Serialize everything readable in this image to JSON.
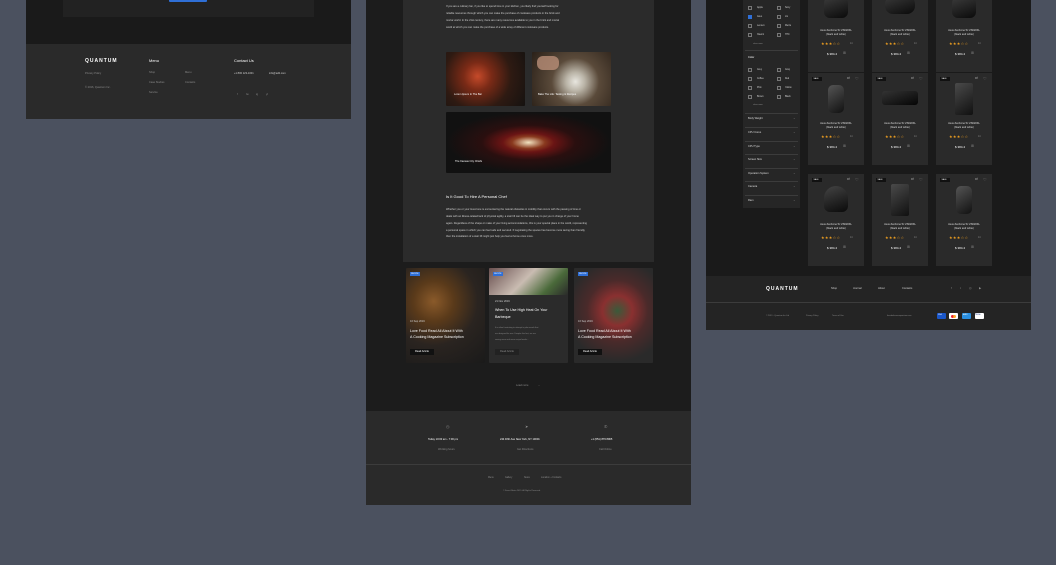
{
  "left": {
    "brand": "QUANTUM",
    "privacy": "Privacy Policy",
    "copyright": "© 2016, Quantum Inc.",
    "menu_title": "Menu",
    "menu_col1": [
      "Shop",
      "Case Studies",
      "Service"
    ],
    "menu_col2": [
      "Menu",
      "Contacts"
    ],
    "contact_title": "Contact Us",
    "phone": "+1 800 123-1001",
    "email": "info@adb.com",
    "social": [
      "f",
      "tw",
      "ig",
      "yt"
    ]
  },
  "middle": {
    "paragraph1": [
      "If you are a culinary fan, if you like to spend time in your kitchen, you likely find yourself looking for",
      "reliable resources through which you can make the purchase of cookware products in the brick and",
      "mortar world. In the 21st century, there are many resources available to you in the brick and mortal",
      "world at which you can make the purchase of a wide array of different cookware products."
    ],
    "photo1_caption": "Lorem Ipsum In The Bar",
    "photo2_caption": "Bake The Life: Tasting & Recipes",
    "photo3_caption": "The Kansas City Chiefs",
    "section_heading": "Is It Good To Hire A Personal Chef",
    "paragraph2": [
      "Whether you or your loved one is encountering the natural obstacles in mobility that occurs with the passing of time or",
      "deals with an illness-related lack of physical agility, a stair lift can be the ideal way to put you in charge of your home",
      "again. Regardless of the shape or make of your living accommodations, this is your special place in the world, representing",
      "a personal space in which you can feel safe and secured. If negotiating the spaces has become more taxing than friendly,",
      "then the installation of a stair lift might just help you feel at home once more."
    ],
    "posts": [
      {
        "tag": "RECIPE",
        "date": "16 Sep 2019",
        "title_lines": [
          "Love Food Read All About It With",
          "A Cooking Magazine Subscription"
        ],
        "button": "Read Article"
      },
      {
        "tag": "RECIPE",
        "date": "21 Nov 2019",
        "title_lines": [
          "When To Use High Heat On Your",
          "Barbeque"
        ],
        "excerpt_lines": [
          "It is often frustrating to attempt to plan meals that",
          "are designed for one. Despite this fact, we are",
          "seeing more and more recipe books..."
        ],
        "button": "Read Article"
      },
      {
        "tag": "RECIPE",
        "date": "16 Sep 2019",
        "title_lines": [
          "Love Food Read All About It With",
          "A Cooking Magazine Subscription"
        ],
        "button": "Read Article"
      }
    ],
    "load_more": "Load more",
    "footer_info": [
      {
        "icon": "clock-icon",
        "glyph": "◷",
        "main": "Today 10:00 am - 7:00 pm",
        "sub": "Working hours"
      },
      {
        "icon": "location-icon",
        "glyph": "➤",
        "main": "244 Fifth Ave New York, NY 10001",
        "sub": "Get Directions"
      },
      {
        "icon": "phone-icon",
        "glyph": "✆",
        "main": "+1 (651) 876 8965",
        "sub": "Call Online"
      }
    ],
    "footer_links": [
      "Menu",
      "Gallery",
      "News",
      "Location + Contacts"
    ],
    "footer_copyright": "© Saucé Bistro 2019. All Rights Reserved."
  },
  "right": {
    "top_filters_col1": [
      "Apple",
      "Asus",
      "Lenovo",
      "Xiaomi"
    ],
    "top_filters_col2": [
      "Sony",
      "LG",
      "Meizu",
      "HTC"
    ],
    "show_more": "show more",
    "color_title": "Color",
    "colors_col1": [
      "Grey",
      "Coffee",
      "Pink",
      "Brown"
    ],
    "colors_col2": [
      "Gray",
      "Red",
      "Yellow",
      "Black"
    ],
    "filter_sections": [
      "Body Weight",
      "CPU Cores",
      "CPU Type",
      "Screen Size",
      "Operation System",
      "Camera",
      "Ram"
    ],
    "product_name_line1": "Asus ZenFone 5z ZS620KL",
    "product_name_line2": "(black and white)",
    "price": "$ 384.4",
    "rating_count": "14",
    "sale_badge": "SALE",
    "brand": "QUANTUM",
    "nav": [
      "Shop",
      "Journal",
      "About",
      "Contacts"
    ],
    "copyright": "© 2019 - Quantum Inc Ltd",
    "privacy": "Privacy Policy",
    "terms": "Terms of Use",
    "email": "theedafermanquantum.com",
    "payments": [
      "VISA",
      "MC",
      "AMEX",
      "PAYPAL"
    ]
  }
}
